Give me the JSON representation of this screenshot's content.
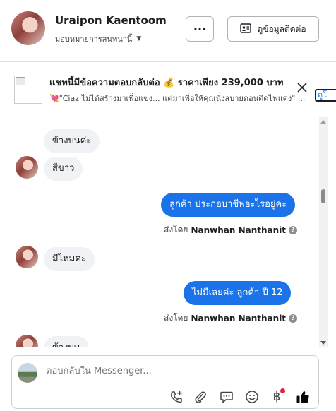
{
  "header": {
    "name": "Uraipon Kaentoom",
    "assign_label": "มอบหมายการสนทนานี้",
    "more_label": "···",
    "contact_label": "ดูข้อมูลติดต่อ"
  },
  "ad": {
    "title": "แชทนี้มีข้อความตอบกลับต่อ 💰 ราคาเพียง 239,000 บาท",
    "subtitle": "💘\"Ciaz ไม่ได้สร้างมาเพื่อแข่ง... แต่มาเพื่อให้คุณนั่งสบายตอนติดไฟแดง\" ...",
    "link_label": "ดูโ"
  },
  "messages": [
    {
      "direction": "in",
      "text": "ข้างบนค่ะ"
    },
    {
      "direction": "in",
      "text": "สีขาว"
    },
    {
      "direction": "out",
      "text": "ลูกค้า ประกอบาชีพอะไรอยู่คะ"
    },
    {
      "direction": "out",
      "sent_prefix": "ส่งโดย",
      "sender": "Nanwhan Nanthanit"
    },
    {
      "direction": "in",
      "text": "มีไหมค่ะ"
    },
    {
      "direction": "out",
      "text": "ไม่มีเลยค่ะ  ลูกค้า  ปี 12"
    },
    {
      "direction": "out",
      "sent_prefix": "ส่งโดย",
      "sender": "Nanwhan Nanthanit"
    },
    {
      "direction": "in",
      "text": "ข้างบน"
    }
  ],
  "composer": {
    "placeholder": "ตอบกลับใน Messenger..."
  },
  "icons": [
    "phone-add-icon",
    "paperclip-icon",
    "saved-reply-icon",
    "emoji-icon",
    "baht-icon",
    "thumbs-up-icon"
  ],
  "colors": {
    "outgoing_bubble": "#1a73e8",
    "incoming_bubble": "#f0f2f5",
    "like_icon": "#050505",
    "notification_dot": "#e41e3f"
  }
}
